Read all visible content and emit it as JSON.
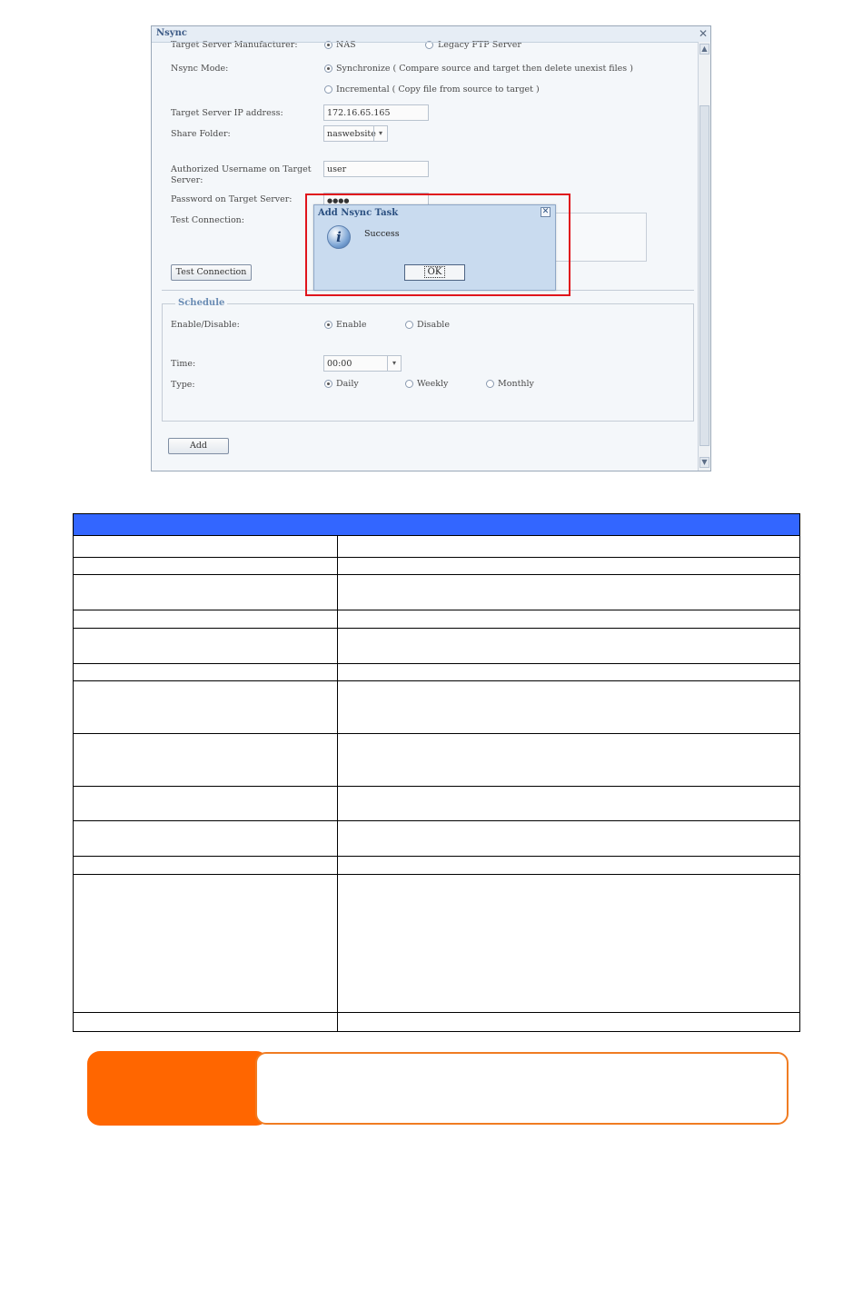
{
  "window": {
    "title": "Nsync",
    "close_glyph": "✕",
    "scroll_up": "▲",
    "scroll_down": "▼"
  },
  "form": {
    "manufacturer": {
      "label": "Target Server Manufacturer:",
      "opt1": "NAS",
      "opt2": "Legacy FTP Server"
    },
    "mode": {
      "label": "Nsync Mode:",
      "opt1": "Synchronize ( Compare source and target then delete unexist files )",
      "opt2": "Incremental ( Copy file from source to target )"
    },
    "ip": {
      "label": "Target Server IP address:",
      "value": "172.16.65.165"
    },
    "share": {
      "label": "Share Folder:",
      "value": "naswebsite",
      "arrow": "▾"
    },
    "username": {
      "label_line1": "Authorized Username on Target",
      "label_line2": "Server:",
      "value": "user"
    },
    "password": {
      "label": "Password on Target Server:",
      "value": "●●●●"
    },
    "test": {
      "label": "Test Connection:",
      "button": "Test Connection"
    }
  },
  "schedule": {
    "legend": "Schedule",
    "enable": {
      "label": "Enable/Disable:",
      "opt1": "Enable",
      "opt2": "Disable"
    },
    "time": {
      "label": "Time:",
      "value": "00:00",
      "arrow": "▾"
    },
    "type": {
      "label": "Type:",
      "opt1": "Daily",
      "opt2": "Weekly",
      "opt3": "Monthly"
    },
    "add_button": "Add"
  },
  "dialog": {
    "title": "Add Nsync Task",
    "close": "✕",
    "icon": "i",
    "message": "Success",
    "ok": "OK"
  },
  "colors": {
    "table_header": "#3366ff",
    "note_tab": "#ff6600",
    "note_border": "#f07c22",
    "highlight": "#e0141c"
  },
  "table": {
    "rows": 15
  }
}
